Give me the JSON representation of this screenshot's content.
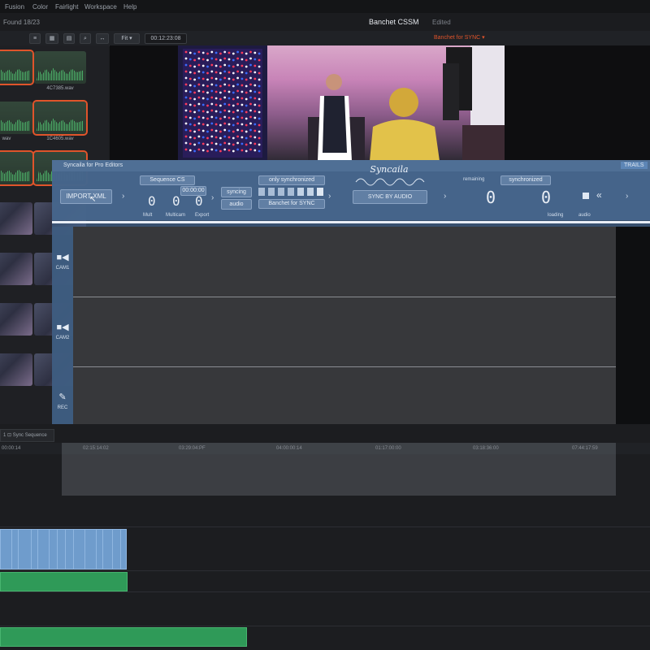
{
  "menu": [
    "Fusion",
    "Color",
    "Fairlight",
    "Workspace",
    "Help"
  ],
  "title": {
    "project": "Banchet CSSM",
    "status": "Edited",
    "timeline_select": "Banchet for SYNC"
  },
  "toolbar": {
    "fit_label": "Fit",
    "timecode": "00:12:23:08",
    "left_label": "Found 18/23"
  },
  "media_clips": [
    {
      "name": "",
      "kind": "audio",
      "selected": true
    },
    {
      "name": "4C7385.wav",
      "kind": "audio",
      "selected": false
    },
    {
      "name": "wav",
      "kind": "audio",
      "selected": false
    },
    {
      "name": "1C4605.wav",
      "kind": "audio",
      "selected": true
    },
    {
      "name": "",
      "kind": "audio",
      "selected": true
    },
    {
      "name": "wav",
      "kind": "audio",
      "selected": true
    },
    {
      "name": "",
      "kind": "video",
      "selected": false
    },
    {
      "name": "",
      "kind": "video",
      "selected": false
    },
    {
      "name": "",
      "kind": "video",
      "selected": false
    },
    {
      "name": "",
      "kind": "video",
      "selected": false
    },
    {
      "name": "",
      "kind": "video",
      "selected": false
    },
    {
      "name": "",
      "kind": "video",
      "selected": false
    },
    {
      "name": "",
      "kind": "video",
      "selected": false
    },
    {
      "name": "",
      "kind": "video",
      "selected": false
    }
  ],
  "plugin": {
    "title": "Syncaila for Pro Editors",
    "import_button": "IMPORT XML",
    "sequence_label": "Sequence CS",
    "fields": [
      "00:00:00",
      "syncing",
      "audio",
      "only synchronized"
    ],
    "sync_button": "SYNC BY AUDIO",
    "small_labels": [
      "Mult",
      "Multicam",
      "Export"
    ],
    "digits_left": [
      "0",
      "0",
      "0"
    ],
    "digits_right": [
      "0",
      "0"
    ],
    "remaining_label": "remaining",
    "sync_field": "synchronized",
    "status_left": "loading",
    "status_right": "audio",
    "side_tab": "TRAILS",
    "tracks": [
      {
        "name": "CAM1",
        "icon": "■◀"
      },
      {
        "name": "CAM2",
        "icon": "■◀"
      },
      {
        "name": "REC",
        "icon": "✎"
      }
    ]
  },
  "timeline": {
    "track_select": "1 ⊡ Sync Sequence",
    "start_tc": "00:00:14",
    "ruler": [
      "02:15:14:02",
      "03:29:04:PF",
      "04:00:00:14",
      "01:17:00:00",
      "03:18:36:00",
      "07:44:17:59"
    ]
  }
}
